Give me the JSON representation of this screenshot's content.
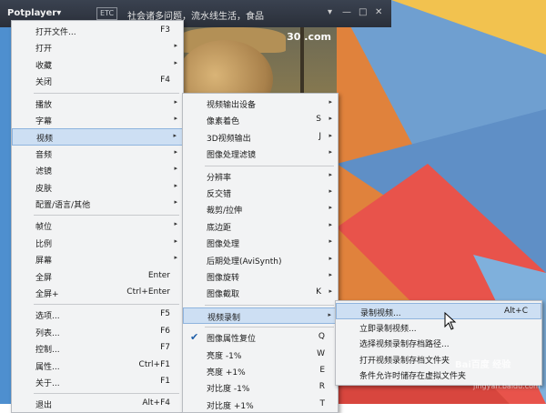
{
  "titlebar": {
    "app_label": "Potplayer",
    "app_arrow": "▾",
    "badge": "ETC",
    "title": "社会诸多问题，流水线生活，食品",
    "controls": [
      "▾",
      "—",
      "□",
      "✕"
    ]
  },
  "video": {
    "watermark": "30 .com"
  },
  "main_menu": [
    {
      "label": "打开文件...",
      "shortcut": "F3"
    },
    {
      "label": "打开",
      "arrow": "▸"
    },
    {
      "label": "收藏",
      "arrow": "▸"
    },
    {
      "label": "关闭",
      "shortcut": "F4"
    },
    {
      "sep": true
    },
    {
      "label": "播放",
      "arrow": "▸"
    },
    {
      "label": "字幕",
      "arrow": "▸"
    },
    {
      "label": "视频",
      "arrow": "▸",
      "highlight": true
    },
    {
      "label": "音频",
      "arrow": "▸"
    },
    {
      "label": "滤镜",
      "arrow": "▸"
    },
    {
      "label": "皮肤",
      "arrow": "▸"
    },
    {
      "label": "配置/语言/其他",
      "arrow": "▸"
    },
    {
      "sep": true
    },
    {
      "label": "帧位",
      "arrow": "▸"
    },
    {
      "label": "比例",
      "arrow": "▸"
    },
    {
      "label": "屏幕",
      "arrow": "▸"
    },
    {
      "label": "全屏",
      "shortcut": "Enter"
    },
    {
      "label": "全屏+",
      "shortcut": "Ctrl+Enter"
    },
    {
      "sep": true
    },
    {
      "label": "选项...",
      "shortcut": "F5"
    },
    {
      "label": "列表...",
      "shortcut": "F6"
    },
    {
      "label": "控制...",
      "shortcut": "F7"
    },
    {
      "label": "属性...",
      "shortcut": "Ctrl+F1"
    },
    {
      "label": "关于...",
      "shortcut": "F1"
    },
    {
      "sep": true
    },
    {
      "label": "退出",
      "shortcut": "Alt+F4"
    }
  ],
  "video_menu": [
    {
      "label": "视频输出设备",
      "arrow": "▸"
    },
    {
      "label": "像素着色",
      "shortcut": "S",
      "arrow": "▸"
    },
    {
      "label": "3D视频输出",
      "shortcut": "J",
      "arrow": "▸"
    },
    {
      "label": "图像处理滤镜",
      "arrow": "▸"
    },
    {
      "sep": true
    },
    {
      "label": "分辨率",
      "arrow": "▸"
    },
    {
      "label": "反交错",
      "arrow": "▸"
    },
    {
      "label": "裁剪/拉伸",
      "arrow": "▸"
    },
    {
      "label": "底边距",
      "arrow": "▸"
    },
    {
      "label": "图像处理",
      "arrow": "▸"
    },
    {
      "label": "后期处理(AviSynth)",
      "arrow": "▸"
    },
    {
      "label": "图像旋转",
      "arrow": "▸"
    },
    {
      "label": "图像截取",
      "shortcut": "K",
      "arrow": "▸"
    },
    {
      "sep": true
    },
    {
      "label": "视频录制",
      "arrow": "▸",
      "highlight": true
    },
    {
      "sep": true
    },
    {
      "label": "图像属性复位",
      "shortcut": "Q",
      "check": "✔"
    },
    {
      "label": "亮度 -1%",
      "shortcut": "W"
    },
    {
      "label": "亮度 +1%",
      "shortcut": "E"
    },
    {
      "label": "对比度 -1%",
      "shortcut": "R"
    },
    {
      "label": "对比度 +1%",
      "shortcut": "T"
    }
  ],
  "record_menu": [
    {
      "label": "录制视频...",
      "shortcut": "Alt+C",
      "highlight": true
    },
    {
      "label": "立即录制视频..."
    },
    {
      "label": "选择视频录制存档路径..."
    },
    {
      "label": "打开视频录制存档文件夹"
    },
    {
      "label": "条件允许时储存在虚拟文件夹"
    }
  ],
  "watermark": {
    "text": "Bai百度 经验",
    "sub": "jingyan.baidu.com"
  },
  "colors": {
    "menu_bg": "#f2f3f4",
    "highlight": "#cddff3",
    "titlebar": "#2f3540"
  }
}
